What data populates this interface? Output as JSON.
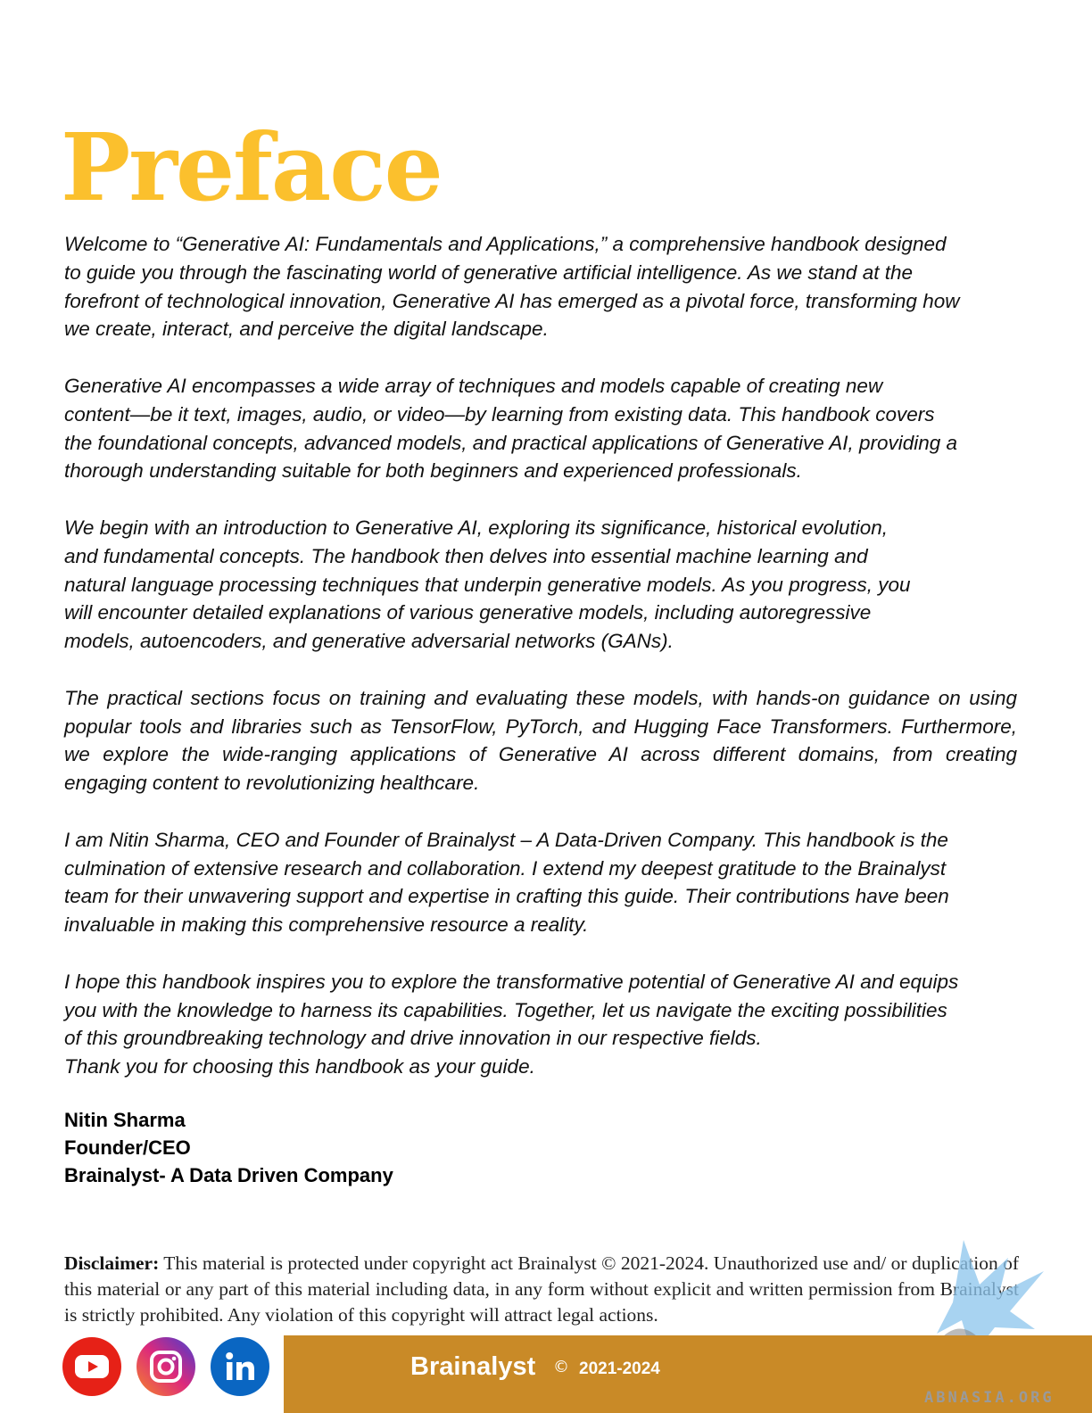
{
  "title": "Preface",
  "paragraphs": [
    "Welcome to “Generative AI: Fundamentals and Applications,” a comprehensive handbook designed\nto guide you through the fascinating world of generative artificial intelligence. As we stand at the\nforefront of technological innovation, Generative AI has emerged as a pivotal force, transforming how\nwe create, interact, and perceive the digital landscape.",
    "Generative AI encompasses a wide array of techniques and models capable of creating new\ncontent—be it text, images, audio, or video—by learning from existing data. This handbook covers\nthe foundational concepts, advanced models, and practical applications of Generative AI, providing a\nthorough understanding suitable for both beginners and experienced professionals.",
    "We begin with an introduction to Generative AI, exploring its significance, historical evolution,\nand fundamental concepts. The handbook then delves into essential machine learning and\nnatural language processing techniques that underpin generative models. As you progress, you\nwill encounter detailed explanations of various generative models, including autoregressive\nmodels, autoencoders, and generative adversarial networks (GANs).",
    "The practical sections focus on training and evaluating these models, with hands-on guidance on using popular tools and libraries such as TensorFlow, PyTorch, and Hugging Face Transformers. Furthermore, we explore the wide-ranging applications of Generative AI across different domains, from creating engaging content to revolutionizing healthcare.",
    "I am Nitin Sharma, CEO and Founder of Brainalyst – A Data-Driven Company. This handbook is the\nculmination of extensive research and collaboration. I extend my deepest gratitude to the Brainalyst\nteam for their unwavering support and expertise in crafting this guide. Their contributions have been\ninvaluable in making this comprehensive resource a reality.",
    "I hope this handbook inspires you to explore the transformative potential of Generative AI and equips\nyou with the knowledge to harness its capabilities. Together, let us navigate the exciting possibilities\nof this groundbreaking technology and drive innovation in our respective fields.\nThank you for choosing this handbook as your guide."
  ],
  "signature": {
    "name": "Nitin Sharma",
    "role": "Founder/CEO",
    "company": "Brainalyst- A Data Driven Company"
  },
  "disclaimer": {
    "label": "Disclaimer:",
    "text": " This material is protected under copyright act Brainalyst © 2021-2024. Unauthorized use and/ or duplication of this material or any part of this material including data, in any form without explicit and written permission from Brainalyst is strictly prohibited. Any violation of this copyright will attract legal actions."
  },
  "footer": {
    "brand": "Brainalyst",
    "copyright_symbol": "©",
    "years": "2021-2024",
    "watermark_site": "ABNASIA.ORG",
    "social_icons": [
      "youtube-icon",
      "instagram-icon",
      "linkedin-icon"
    ]
  },
  "colors": {
    "title": "#FBC02D",
    "footer_bar": "#C98A27",
    "youtube": "#E62117",
    "linkedin": "#0A66C2"
  }
}
